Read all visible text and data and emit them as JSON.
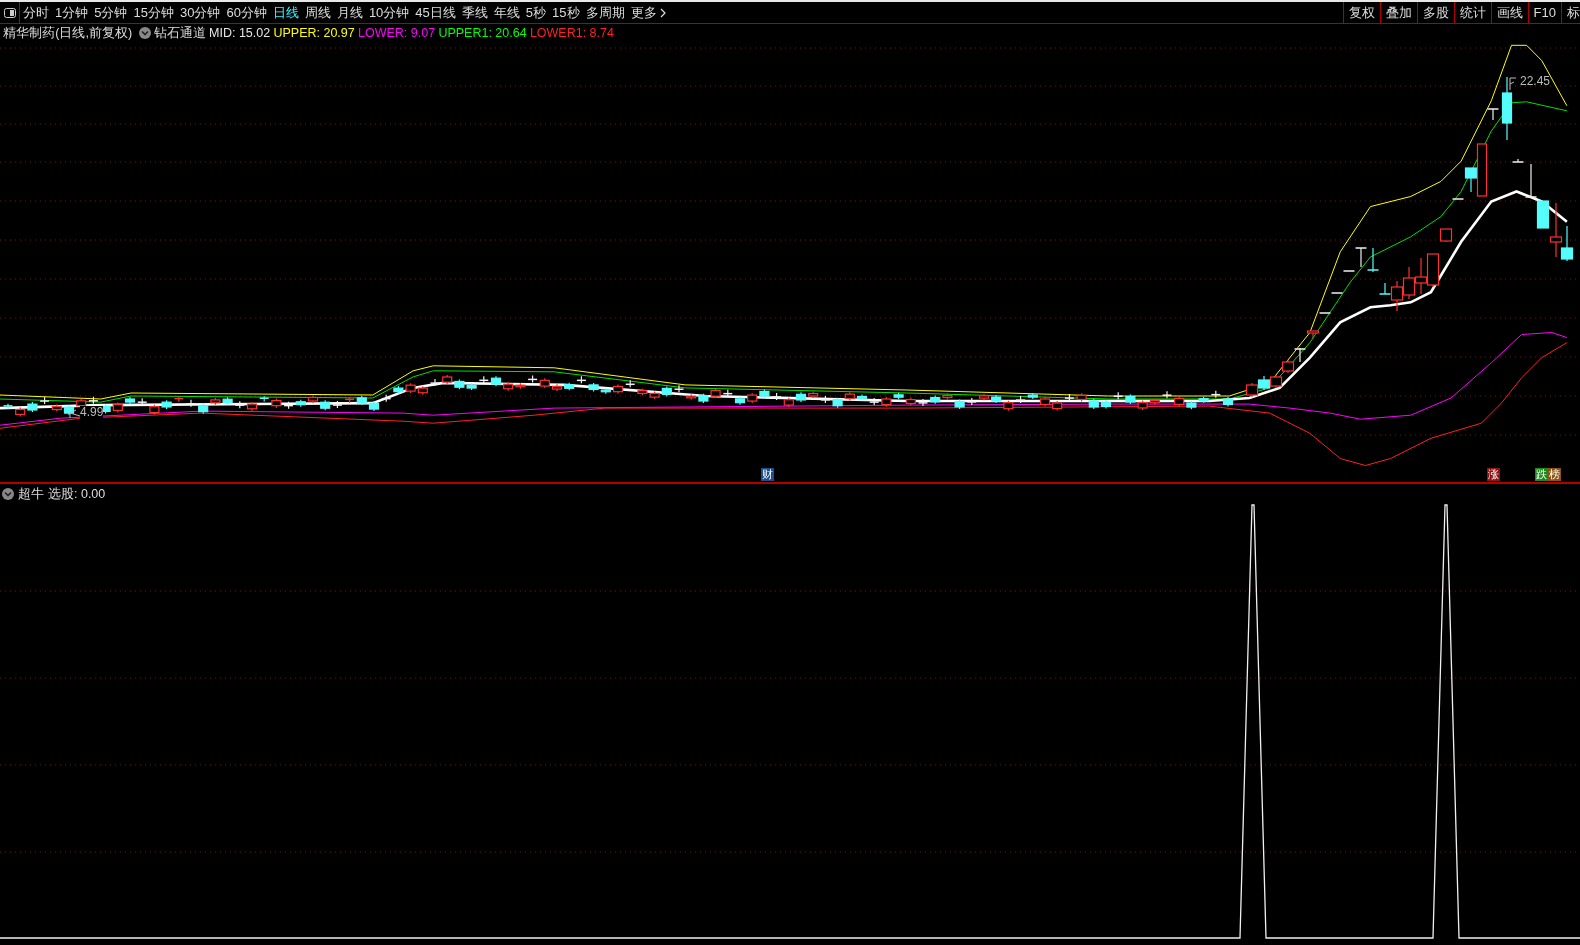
{
  "toolbar": {
    "periods": [
      {
        "label": "分时",
        "selected": false
      },
      {
        "label": "1分钟",
        "selected": false
      },
      {
        "label": "5分钟",
        "selected": false
      },
      {
        "label": "15分钟",
        "selected": false
      },
      {
        "label": "30分钟",
        "selected": false
      },
      {
        "label": "60分钟",
        "selected": false
      },
      {
        "label": "日线",
        "selected": true
      },
      {
        "label": "周线",
        "selected": false
      },
      {
        "label": "月线",
        "selected": false
      },
      {
        "label": "10分钟",
        "selected": false
      },
      {
        "label": "45日线",
        "selected": false
      },
      {
        "label": "季线",
        "selected": false
      },
      {
        "label": "年线",
        "selected": false
      },
      {
        "label": "5秒",
        "selected": false
      },
      {
        "label": "15秒",
        "selected": false
      },
      {
        "label": "多周期",
        "selected": false
      }
    ],
    "more": "更多",
    "tools": [
      "复权",
      "叠加",
      "多股",
      "统计",
      "画线",
      "F10",
      "标"
    ]
  },
  "legend": {
    "title": "精华制药(日线,前复权)",
    "indicator": "钻石通道",
    "values": [
      {
        "text": "MID: 15.02",
        "color": "#e6e6e6"
      },
      {
        "text": "UPPER: 20.97",
        "color": "#ffff00"
      },
      {
        "text": "LOWER: 9.07",
        "color": "#ff00ff"
      },
      {
        "text": "UPPER1: 20.64",
        "color": "#00ff00"
      },
      {
        "text": "LOWER1: 8.74",
        "color": "#ff2020"
      }
    ]
  },
  "price_chart": {
    "high_label": "22.45",
    "low_label": "4.99",
    "markers": [
      {
        "text": "财",
        "color": "#1c4f8c"
      },
      {
        "text": "涨",
        "color": "#8b1414"
      },
      {
        "text": "跌",
        "color": "#1a8a1a"
      },
      {
        "text": "榜",
        "color": "#8a5414"
      }
    ]
  },
  "signal_panel": {
    "name": "超牛",
    "value": "选股: 0.00"
  }
}
